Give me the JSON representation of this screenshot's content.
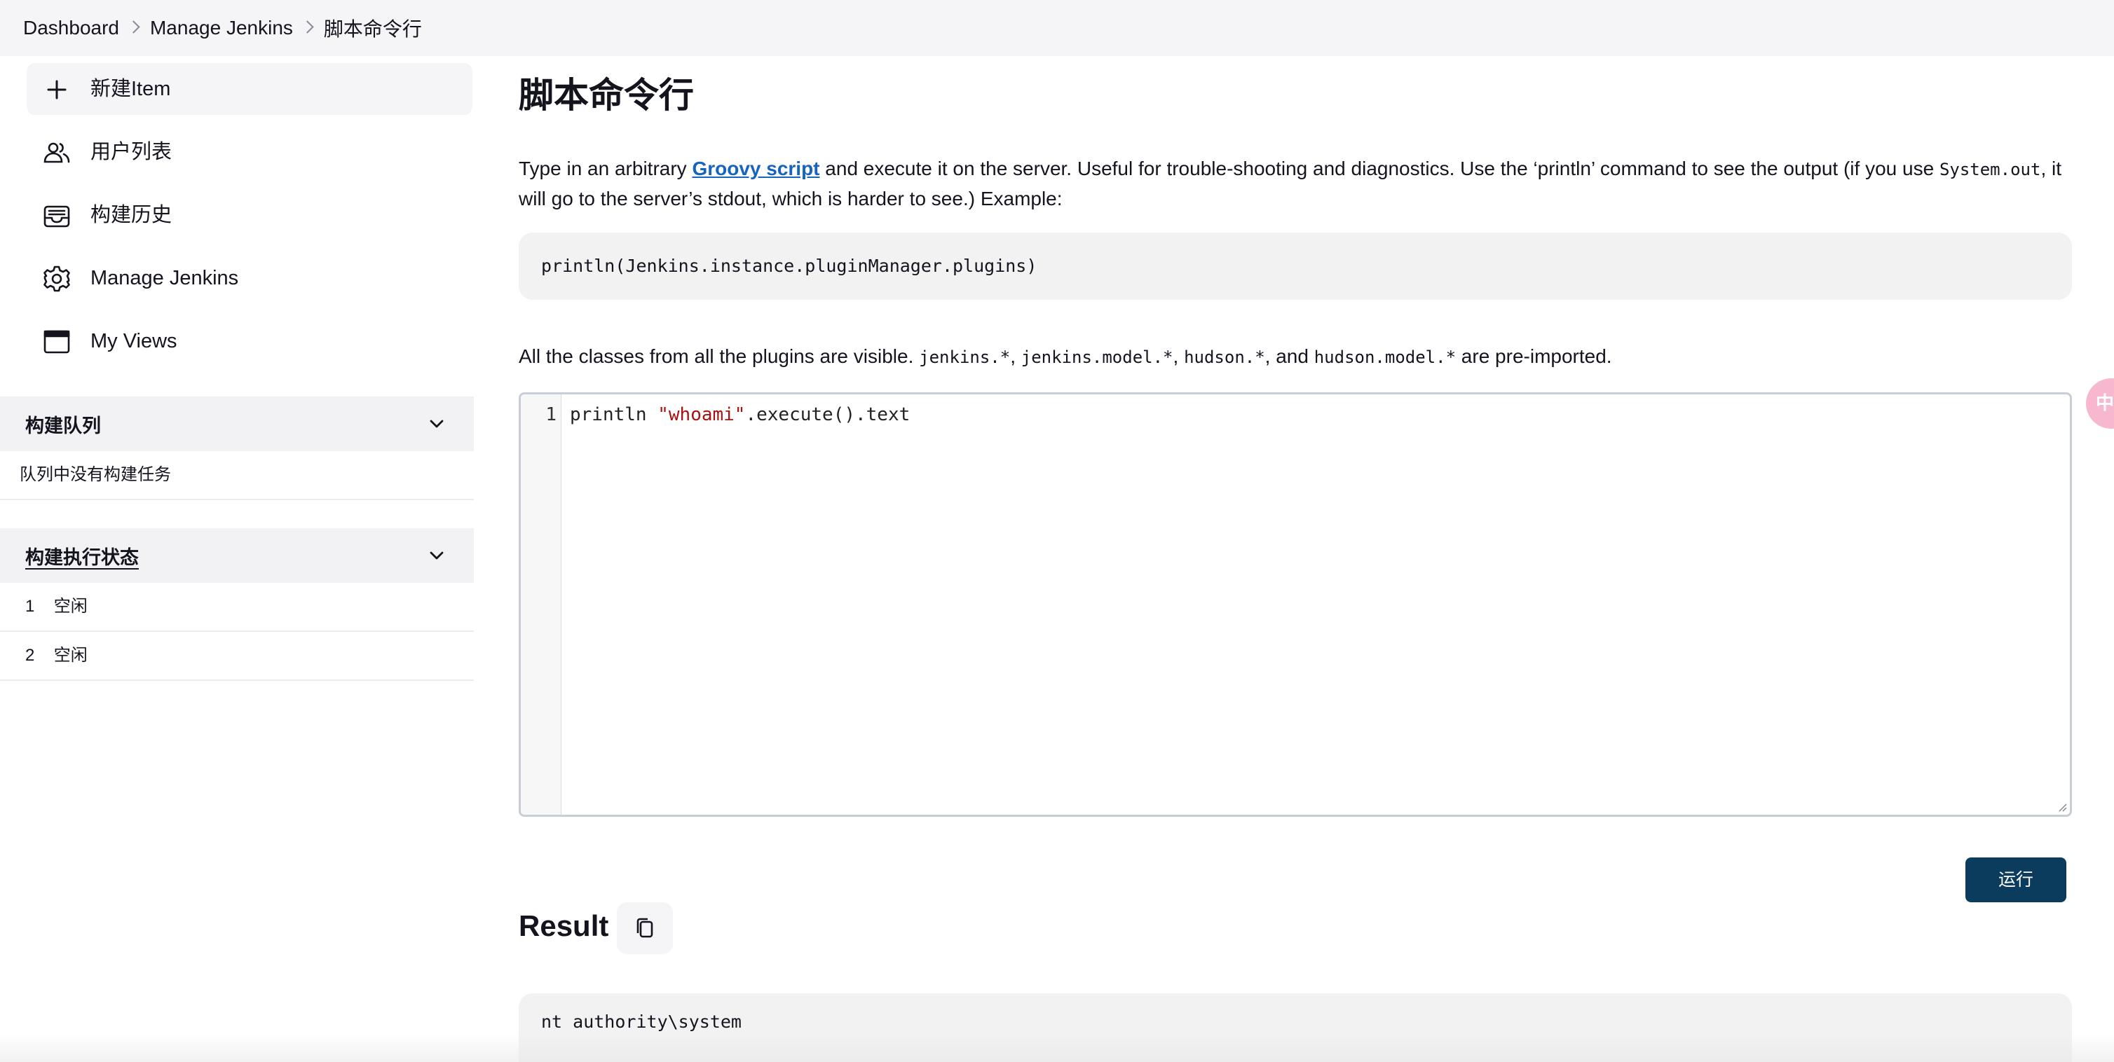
{
  "breadcrumb": {
    "items": [
      "Dashboard",
      "Manage Jenkins",
      "脚本命令行"
    ]
  },
  "sidebar": {
    "tasks": [
      {
        "label": "新建Item",
        "icon": "plus-icon"
      },
      {
        "label": "用户列表",
        "icon": "people-icon"
      },
      {
        "label": "构建历史",
        "icon": "inbox-icon"
      },
      {
        "label": "Manage Jenkins",
        "icon": "gear-icon"
      },
      {
        "label": "My Views",
        "icon": "window-icon"
      }
    ],
    "build_queue": {
      "title": "构建队列",
      "empty_text": "队列中没有构建任务"
    },
    "executors": {
      "title": "构建执行状态",
      "rows": [
        {
          "number": "1",
          "status": "空闲"
        },
        {
          "number": "2",
          "status": "空闲"
        }
      ]
    }
  },
  "main": {
    "title": "脚本命令行",
    "description": {
      "before_link": "Type in an arbitrary ",
      "link_text": "Groovy script",
      "after_link": " and execute it on the server. Useful for trouble-shooting and diagnostics. Use the ‘println’ command to see the output (if you use ",
      "code": "System.out",
      "tail": ", it will go to the server’s stdout, which is harder to see.) Example:"
    },
    "example_code": "println(Jenkins.instance.pluginManager.plugins)",
    "classes_note": {
      "prefix": "All the classes from all the plugins are visible. ",
      "pkg1": "jenkins.*",
      "sep1": ", ",
      "pkg2": "jenkins.model.*",
      "sep2": ", ",
      "pkg3": "hudson.*",
      "sep3": ", and ",
      "pkg4": "hudson.model.*",
      "suffix": " are pre-imported."
    },
    "editor": {
      "line_number": "1",
      "code_before": "println ",
      "code_string": "\"whoami\"",
      "code_after": ".execute().text"
    },
    "run_label": "运行",
    "result_title": "Result",
    "result_output": "nt authority\\system"
  },
  "floating_badge": "中"
}
